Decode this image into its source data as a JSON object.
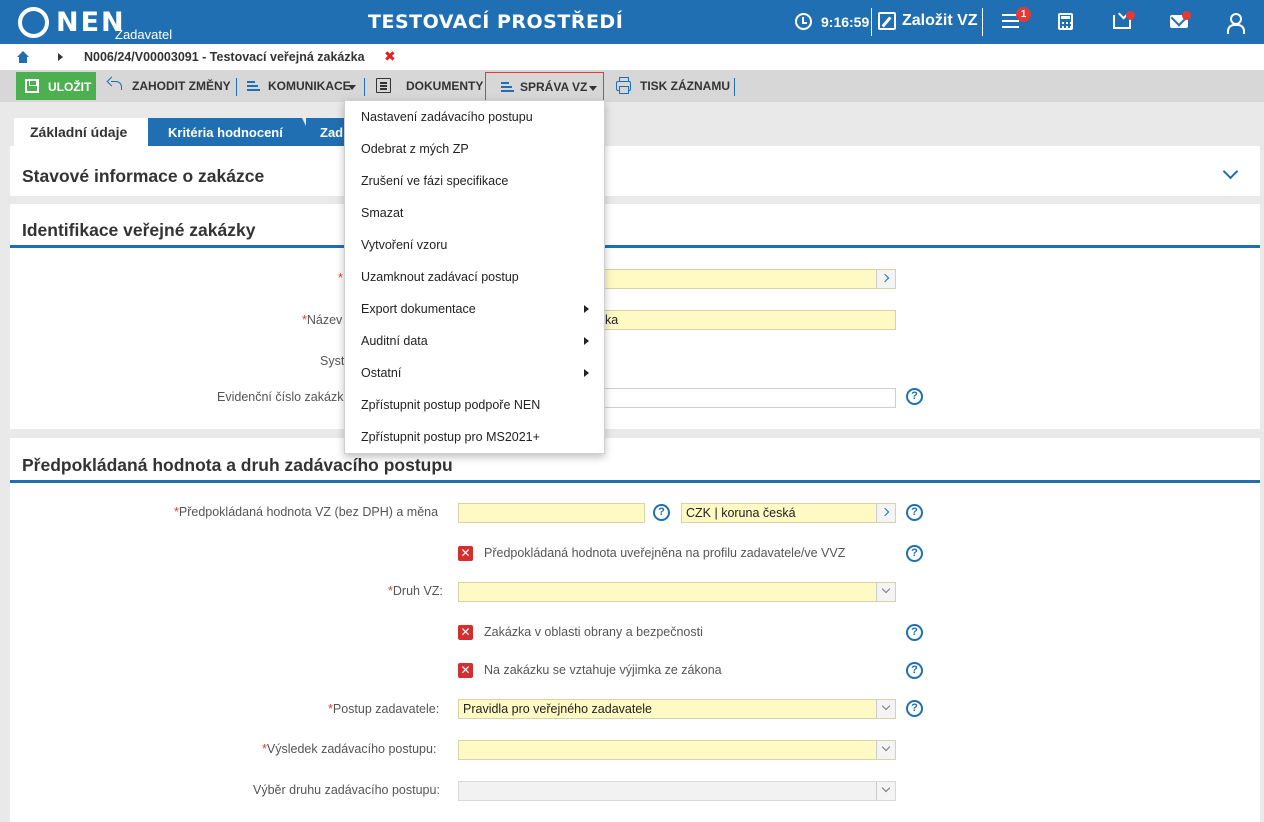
{
  "header": {
    "logo_text": "NEN",
    "logo_sub": "Zadavatel",
    "env_title": "TESTOVACÍ PROSTŘEDÍ",
    "clock": "9:16:59",
    "create_label": "Založit VZ",
    "notif_count": "1",
    "accent_color": "#1f6fb2",
    "badge_color": "#e53935"
  },
  "breadcrumb": {
    "title": "N006/24/V00003091 - Testovací veřejná zakázka",
    "close": "✖"
  },
  "toolbar": {
    "save": "ULOŽIT",
    "discard": "ZAHODIT ZMĚNY",
    "communication": "KOMUNIKACE",
    "documents": "DOKUMENTY",
    "manage": "SPRÁVA VZ",
    "print": "TISK ZÁZNAMU"
  },
  "tabs": [
    {
      "label": "Základní údaje"
    },
    {
      "label": "Kritéria hodnocení"
    },
    {
      "label": "Zad"
    }
  ],
  "sections": {
    "status": {
      "title": "Stavové informace o zakázce"
    },
    "identification": {
      "title": "Identifikace veřejné zakázky",
      "fields": {
        "name_label": "Název",
        "name_value": "ka",
        "system_label": "Syst",
        "evid_label": "Evidenční číslo zakázk"
      }
    },
    "value": {
      "title": "Předpokládaná hodnota a druh zadávacího postupu",
      "est_value_label": "Předpokládaná hodnota VZ (bez DPH) a měna",
      "currency_value": "CZK | koruna česká",
      "published_label": "Předpokládaná hodnota uveřejněna na profilu zadavatele/ve VVZ",
      "type_label": "Druh VZ:",
      "defense_label": "Zakázka v oblasti obrany a bezpečnosti",
      "exception_label": "Na zakázku se vztahuje výjimka ze zákona",
      "procedure_label": "Postup zadavatele:",
      "procedure_value": "Pravidla pro veřejného zadavatele",
      "result_label": "Výsledek zadávacího postupu:",
      "choice_label": "Výběr druhu zadávacího postupu:"
    }
  },
  "dropdown": {
    "items": [
      {
        "label": "Nastavení zadávacího postupu",
        "submenu": false
      },
      {
        "label": "Odebrat z mých ZP",
        "submenu": false
      },
      {
        "label": "Zrušení ve fázi specifikace",
        "submenu": false
      },
      {
        "label": "Smazat",
        "submenu": false
      },
      {
        "label": "Vytvoření vzoru",
        "submenu": false
      },
      {
        "label": "Uzamknout zadávací postup",
        "submenu": false
      },
      {
        "label": "Export dokumentace",
        "submenu": true
      },
      {
        "label": "Auditní data",
        "submenu": true
      },
      {
        "label": "Ostatní",
        "submenu": true
      },
      {
        "label": "Zpřístupnit postup podpoře NEN",
        "submenu": false
      },
      {
        "label": "Zpřístupnit postup pro MS2021+",
        "submenu": false
      }
    ]
  }
}
